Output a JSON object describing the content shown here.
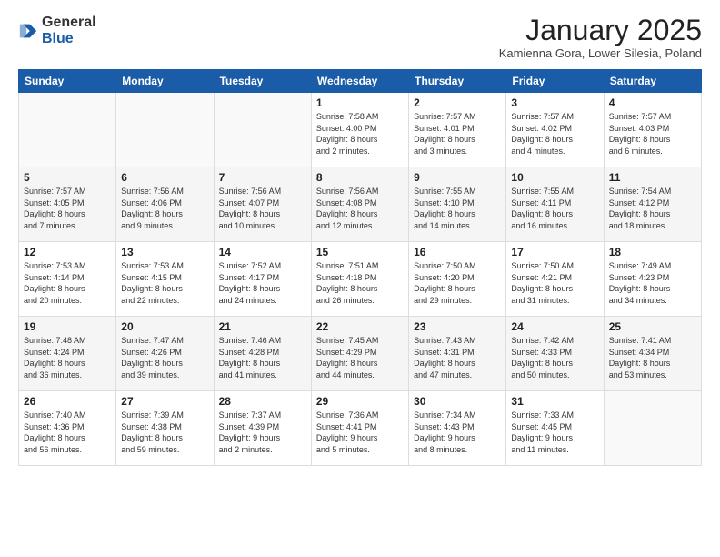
{
  "header": {
    "logo_line1": "General",
    "logo_line2": "Blue",
    "month": "January 2025",
    "location": "Kamienna Gora, Lower Silesia, Poland"
  },
  "days_of_week": [
    "Sunday",
    "Monday",
    "Tuesday",
    "Wednesday",
    "Thursday",
    "Friday",
    "Saturday"
  ],
  "weeks": [
    [
      {
        "day": "",
        "info": ""
      },
      {
        "day": "",
        "info": ""
      },
      {
        "day": "",
        "info": ""
      },
      {
        "day": "1",
        "info": "Sunrise: 7:58 AM\nSunset: 4:00 PM\nDaylight: 8 hours\nand 2 minutes."
      },
      {
        "day": "2",
        "info": "Sunrise: 7:57 AM\nSunset: 4:01 PM\nDaylight: 8 hours\nand 3 minutes."
      },
      {
        "day": "3",
        "info": "Sunrise: 7:57 AM\nSunset: 4:02 PM\nDaylight: 8 hours\nand 4 minutes."
      },
      {
        "day": "4",
        "info": "Sunrise: 7:57 AM\nSunset: 4:03 PM\nDaylight: 8 hours\nand 6 minutes."
      }
    ],
    [
      {
        "day": "5",
        "info": "Sunrise: 7:57 AM\nSunset: 4:05 PM\nDaylight: 8 hours\nand 7 minutes."
      },
      {
        "day": "6",
        "info": "Sunrise: 7:56 AM\nSunset: 4:06 PM\nDaylight: 8 hours\nand 9 minutes."
      },
      {
        "day": "7",
        "info": "Sunrise: 7:56 AM\nSunset: 4:07 PM\nDaylight: 8 hours\nand 10 minutes."
      },
      {
        "day": "8",
        "info": "Sunrise: 7:56 AM\nSunset: 4:08 PM\nDaylight: 8 hours\nand 12 minutes."
      },
      {
        "day": "9",
        "info": "Sunrise: 7:55 AM\nSunset: 4:10 PM\nDaylight: 8 hours\nand 14 minutes."
      },
      {
        "day": "10",
        "info": "Sunrise: 7:55 AM\nSunset: 4:11 PM\nDaylight: 8 hours\nand 16 minutes."
      },
      {
        "day": "11",
        "info": "Sunrise: 7:54 AM\nSunset: 4:12 PM\nDaylight: 8 hours\nand 18 minutes."
      }
    ],
    [
      {
        "day": "12",
        "info": "Sunrise: 7:53 AM\nSunset: 4:14 PM\nDaylight: 8 hours\nand 20 minutes."
      },
      {
        "day": "13",
        "info": "Sunrise: 7:53 AM\nSunset: 4:15 PM\nDaylight: 8 hours\nand 22 minutes."
      },
      {
        "day": "14",
        "info": "Sunrise: 7:52 AM\nSunset: 4:17 PM\nDaylight: 8 hours\nand 24 minutes."
      },
      {
        "day": "15",
        "info": "Sunrise: 7:51 AM\nSunset: 4:18 PM\nDaylight: 8 hours\nand 26 minutes."
      },
      {
        "day": "16",
        "info": "Sunrise: 7:50 AM\nSunset: 4:20 PM\nDaylight: 8 hours\nand 29 minutes."
      },
      {
        "day": "17",
        "info": "Sunrise: 7:50 AM\nSunset: 4:21 PM\nDaylight: 8 hours\nand 31 minutes."
      },
      {
        "day": "18",
        "info": "Sunrise: 7:49 AM\nSunset: 4:23 PM\nDaylight: 8 hours\nand 34 minutes."
      }
    ],
    [
      {
        "day": "19",
        "info": "Sunrise: 7:48 AM\nSunset: 4:24 PM\nDaylight: 8 hours\nand 36 minutes."
      },
      {
        "day": "20",
        "info": "Sunrise: 7:47 AM\nSunset: 4:26 PM\nDaylight: 8 hours\nand 39 minutes."
      },
      {
        "day": "21",
        "info": "Sunrise: 7:46 AM\nSunset: 4:28 PM\nDaylight: 8 hours\nand 41 minutes."
      },
      {
        "day": "22",
        "info": "Sunrise: 7:45 AM\nSunset: 4:29 PM\nDaylight: 8 hours\nand 44 minutes."
      },
      {
        "day": "23",
        "info": "Sunrise: 7:43 AM\nSunset: 4:31 PM\nDaylight: 8 hours\nand 47 minutes."
      },
      {
        "day": "24",
        "info": "Sunrise: 7:42 AM\nSunset: 4:33 PM\nDaylight: 8 hours\nand 50 minutes."
      },
      {
        "day": "25",
        "info": "Sunrise: 7:41 AM\nSunset: 4:34 PM\nDaylight: 8 hours\nand 53 minutes."
      }
    ],
    [
      {
        "day": "26",
        "info": "Sunrise: 7:40 AM\nSunset: 4:36 PM\nDaylight: 8 hours\nand 56 minutes."
      },
      {
        "day": "27",
        "info": "Sunrise: 7:39 AM\nSunset: 4:38 PM\nDaylight: 8 hours\nand 59 minutes."
      },
      {
        "day": "28",
        "info": "Sunrise: 7:37 AM\nSunset: 4:39 PM\nDaylight: 9 hours\nand 2 minutes."
      },
      {
        "day": "29",
        "info": "Sunrise: 7:36 AM\nSunset: 4:41 PM\nDaylight: 9 hours\nand 5 minutes."
      },
      {
        "day": "30",
        "info": "Sunrise: 7:34 AM\nSunset: 4:43 PM\nDaylight: 9 hours\nand 8 minutes."
      },
      {
        "day": "31",
        "info": "Sunrise: 7:33 AM\nSunset: 4:45 PM\nDaylight: 9 hours\nand 11 minutes."
      },
      {
        "day": "",
        "info": ""
      }
    ]
  ]
}
